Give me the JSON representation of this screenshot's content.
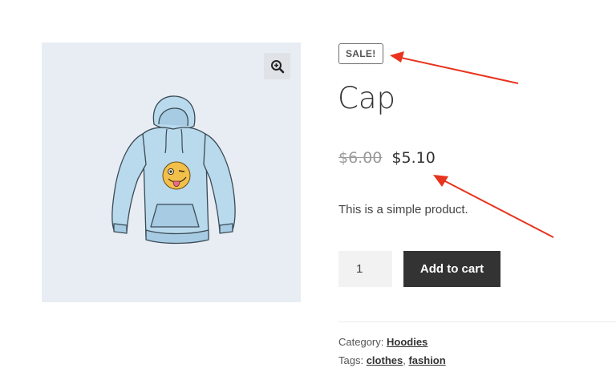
{
  "product": {
    "badge": "SALE!",
    "title": "Cap",
    "price_old": "$6.00",
    "price_new": "$5.10",
    "description": "This is a simple product.",
    "quantity": "1",
    "add_to_cart_label": "Add to cart",
    "category_label": "Category:",
    "category": "Hoodies",
    "tags_label": "Tags:",
    "tags": [
      "clothes",
      "fashion"
    ],
    "tag_separator": ","
  },
  "icons": {
    "zoom": "zoom-in-icon",
    "image": "hoodie-image"
  },
  "colors": {
    "gallery_bg": "#e8edf3",
    "button_bg": "#333333",
    "arrow": "#e8331e",
    "old_price": "#9a9a9a"
  }
}
